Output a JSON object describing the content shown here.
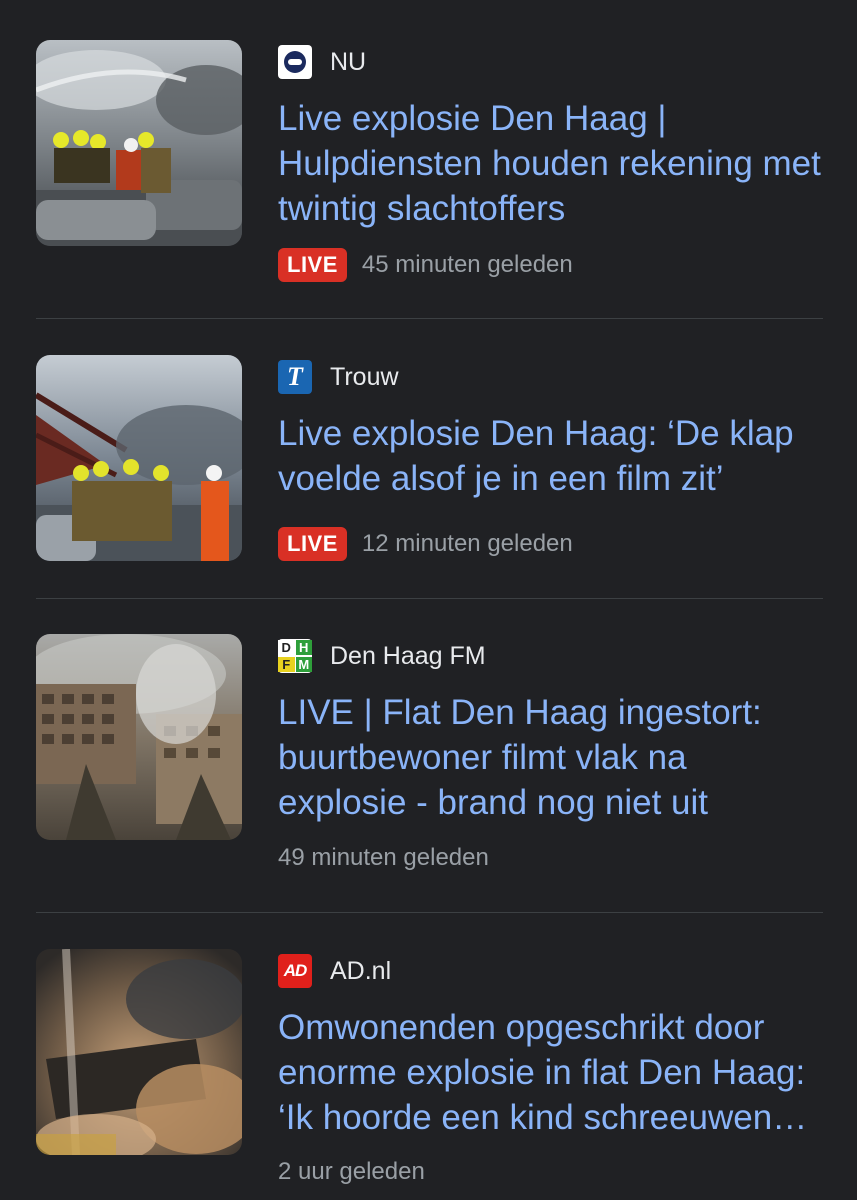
{
  "articles": [
    {
      "source": "NU",
      "logo_icon": "nu-logo-icon",
      "headline": "Live explosie Den Haag | Hulpdiensten houden rekening met twintig slachtoffers",
      "live_label": "LIVE",
      "time": "45 minuten geleden"
    },
    {
      "source": "Trouw",
      "logo_icon": "trouw-logo-icon",
      "logo_text": "T",
      "headline": "Live explosie Den Haag: ‘De klap voelde alsof je in een film zit’",
      "live_label": "LIVE",
      "time": "12 minuten geleden"
    },
    {
      "source": "Den Haag FM",
      "logo_icon": "den-haag-fm-logo-icon",
      "logo_text": [
        "D",
        "H",
        "F",
        "M"
      ],
      "headline": "LIVE | Flat Den Haag ingestort: buurtbewoner filmt vlak na explosie - brand nog niet uit",
      "time": "49 minuten geleden"
    },
    {
      "source": "AD.nl",
      "logo_icon": "ad-logo-icon",
      "logo_text": "AD",
      "headline": "Omwonenden opgeschrikt door enorme explosie in flat Den Haag: ‘Ik hoorde een kind schreeuwen…",
      "time": "2 uur geleden"
    }
  ],
  "colors": {
    "background": "#202124",
    "headline": "#8ab4f8",
    "live_badge": "#d93025",
    "secondary_text": "#9aa0a6"
  }
}
